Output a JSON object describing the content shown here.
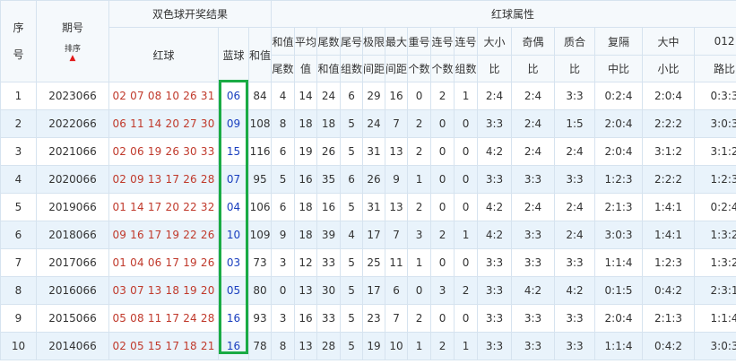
{
  "header": {
    "seq": "序号",
    "period": "期号",
    "sort": "排序",
    "draw_group": "双色球开奖结果",
    "red_group": "红球属性",
    "red": "红球",
    "blue": "蓝球",
    "sum": "和值",
    "attrs": [
      [
        "和值",
        "尾数"
      ],
      [
        "平均",
        "值"
      ],
      [
        "尾数",
        "和值"
      ],
      [
        "尾号",
        "组数"
      ],
      [
        "极限",
        "间距"
      ],
      [
        "最大",
        "间距"
      ],
      [
        "重号",
        "个数"
      ],
      [
        "连号",
        "个数"
      ],
      [
        "连号",
        "组数"
      ],
      [
        "大小",
        "比"
      ],
      [
        "奇偶",
        "比"
      ],
      [
        "质合",
        "比"
      ],
      [
        "复隔",
        "中比"
      ],
      [
        "大中",
        "小比"
      ],
      [
        "012",
        "路比"
      ]
    ]
  },
  "rows": [
    {
      "seq": "1",
      "period": "2023066",
      "red": "02 07 08 10 26 31",
      "blue": "06",
      "sum": "84",
      "v": [
        "4",
        "14",
        "24",
        "6",
        "29",
        "16",
        "0",
        "2",
        "1",
        "2:4",
        "2:4",
        "3:3",
        "0:2:4",
        "2:0:4",
        "0:3:3"
      ]
    },
    {
      "seq": "2",
      "period": "2022066",
      "red": "06 11 14 20 27 30",
      "blue": "09",
      "sum": "108",
      "v": [
        "8",
        "18",
        "18",
        "5",
        "24",
        "7",
        "2",
        "0",
        "0",
        "3:3",
        "2:4",
        "1:5",
        "2:0:4",
        "2:2:2",
        "3:0:3"
      ]
    },
    {
      "seq": "3",
      "period": "2021066",
      "red": "02 06 19 26 30 33",
      "blue": "15",
      "sum": "116",
      "v": [
        "6",
        "19",
        "26",
        "5",
        "31",
        "13",
        "2",
        "0",
        "0",
        "4:2",
        "2:4",
        "2:4",
        "2:0:4",
        "3:1:2",
        "3:1:2"
      ]
    },
    {
      "seq": "4",
      "period": "2020066",
      "red": "02 09 13 17 26 28",
      "blue": "07",
      "sum": "95",
      "v": [
        "5",
        "16",
        "35",
        "6",
        "26",
        "9",
        "1",
        "0",
        "0",
        "3:3",
        "3:3",
        "3:3",
        "1:2:3",
        "2:2:2",
        "1:2:3"
      ]
    },
    {
      "seq": "5",
      "period": "2019066",
      "red": "01 14 17 20 22 32",
      "blue": "04",
      "sum": "106",
      "v": [
        "6",
        "18",
        "16",
        "5",
        "31",
        "13",
        "2",
        "0",
        "0",
        "4:2",
        "2:4",
        "2:4",
        "2:1:3",
        "1:4:1",
        "0:2:4"
      ]
    },
    {
      "seq": "6",
      "period": "2018066",
      "red": "09 16 17 19 22 26",
      "blue": "10",
      "sum": "109",
      "v": [
        "9",
        "18",
        "39",
        "4",
        "17",
        "7",
        "3",
        "2",
        "1",
        "4:2",
        "3:3",
        "2:4",
        "3:0:3",
        "1:4:1",
        "1:3:2"
      ]
    },
    {
      "seq": "7",
      "period": "2017066",
      "red": "01 04 06 17 19 26",
      "blue": "03",
      "sum": "73",
      "v": [
        "3",
        "12",
        "33",
        "5",
        "25",
        "11",
        "1",
        "0",
        "0",
        "3:3",
        "3:3",
        "3:3",
        "1:1:4",
        "1:2:3",
        "1:3:2"
      ]
    },
    {
      "seq": "8",
      "period": "2016066",
      "red": "03 07 13 18 19 20",
      "blue": "05",
      "sum": "80",
      "v": [
        "0",
        "13",
        "30",
        "5",
        "17",
        "6",
        "0",
        "3",
        "2",
        "3:3",
        "4:2",
        "4:2",
        "0:1:5",
        "0:4:2",
        "2:3:1"
      ]
    },
    {
      "seq": "9",
      "period": "2015066",
      "red": "05 08 11 17 24 28",
      "blue": "16",
      "sum": "93",
      "v": [
        "3",
        "16",
        "33",
        "5",
        "23",
        "7",
        "2",
        "0",
        "0",
        "3:3",
        "3:3",
        "3:3",
        "2:0:4",
        "2:1:3",
        "1:1:4"
      ]
    },
    {
      "seq": "10",
      "period": "2014066",
      "red": "02 05 15 17 18 21",
      "blue": "16",
      "sum": "78",
      "v": [
        "8",
        "13",
        "28",
        "5",
        "19",
        "10",
        "1",
        "2",
        "1",
        "3:3",
        "3:3",
        "3:3",
        "1:1:4",
        "0:4:2",
        "3:0:3"
      ]
    }
  ],
  "colors": {
    "red_ball": "#c0392b",
    "blue_ball": "#1a3fbf",
    "header_bg": "#f5f9fc",
    "alt_row_bg": "#e9f3fb",
    "border": "#d6e3ef",
    "highlight": "#1aab44"
  }
}
